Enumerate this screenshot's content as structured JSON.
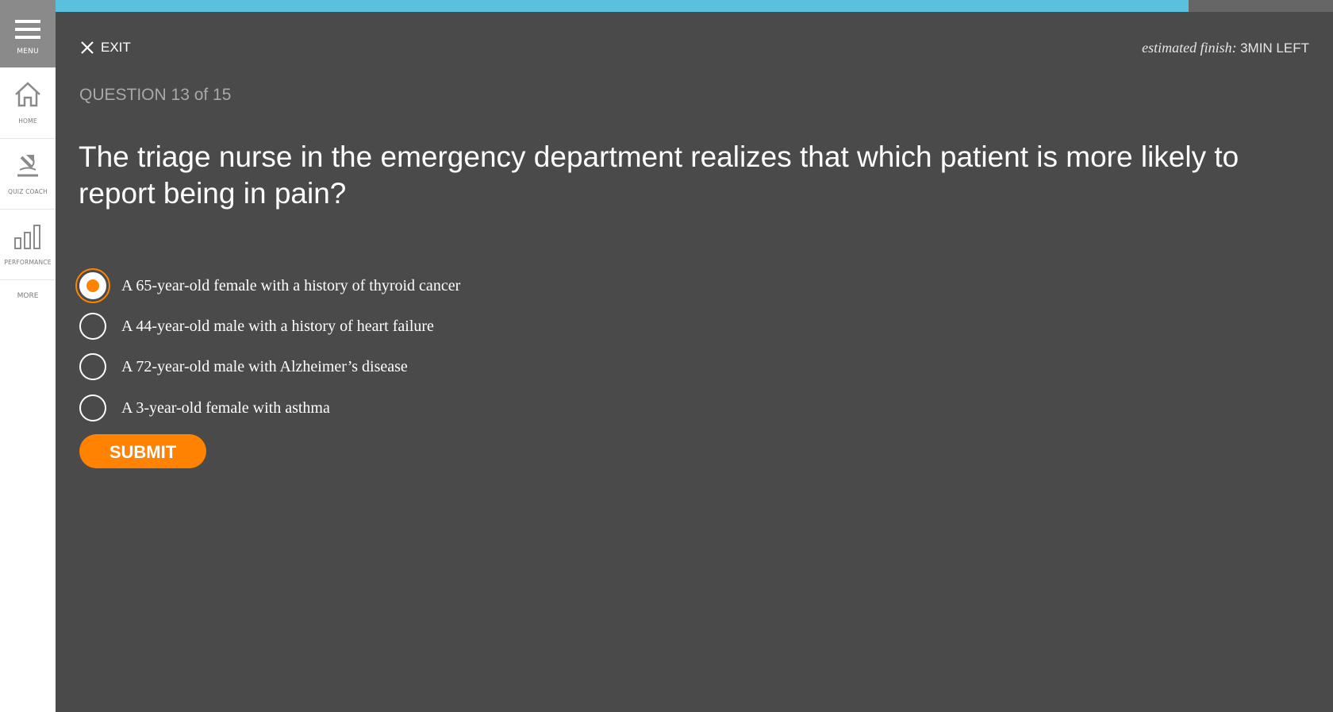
{
  "sidebar": {
    "menu_label": "MENU",
    "items": [
      {
        "label": "HOME",
        "icon": "home-icon"
      },
      {
        "label": "QUIZ COACH",
        "icon": "quiz-coach-icon"
      },
      {
        "label": "PERFORMANCE",
        "icon": "performance-icon"
      }
    ],
    "more_label": "MORE"
  },
  "progress": {
    "value_percent": 88.7,
    "fill_color": "#5bc0de",
    "track_color": "#666666"
  },
  "header": {
    "exit_label": "EXIT",
    "estimate_prefix": "estimated finish:",
    "estimate_value": "3MIN LEFT"
  },
  "quiz": {
    "question_counter": "QUESTION 13 of 15",
    "question_text": "The triage nurse in the emergency department realizes that which patient is more likely to report being in pain?",
    "options": [
      {
        "text": "A 65-year-old female with a history of thyroid cancer",
        "selected": true
      },
      {
        "text": "A 44-year-old male with a history of heart failure",
        "selected": false
      },
      {
        "text": "A 72-year-old male with Alzheimer’s disease",
        "selected": false
      },
      {
        "text": "A 3-year-old female with asthma",
        "selected": false
      }
    ],
    "submit_label": "SUBMIT"
  },
  "colors": {
    "accent": "#ff8200",
    "background": "#4a4a4a"
  }
}
